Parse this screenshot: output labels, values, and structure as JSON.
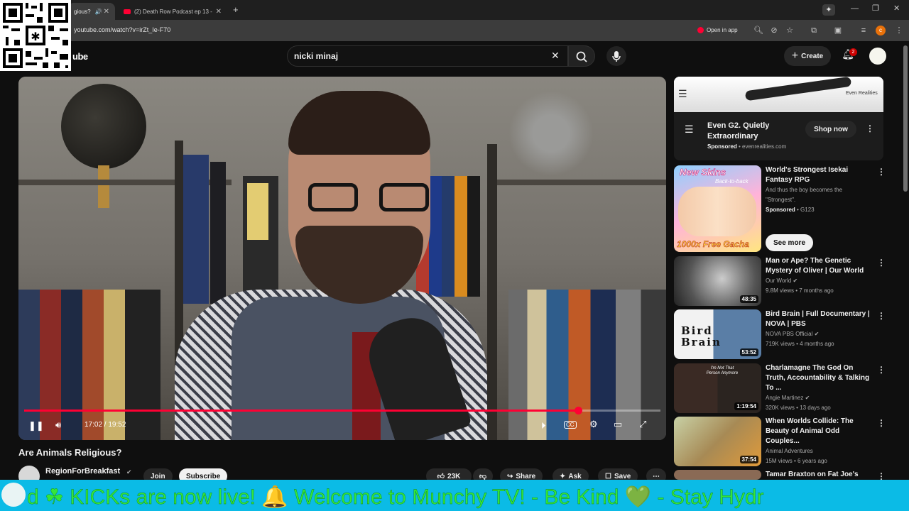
{
  "browser": {
    "tabs": [
      {
        "label": "gious?"
      },
      {
        "label": "(2) Death Row Podcast ep 13 -"
      }
    ],
    "new_tab_icon": "plus-icon",
    "url": "youtube.com/watch?v=irZt_Ie-F70",
    "open_in_app": "Open in app",
    "profile_initial": "c"
  },
  "header": {
    "logo_text": "ube",
    "search_value": "nicki minaj",
    "create_label": "Create",
    "notification_count": "2"
  },
  "player": {
    "progress_fraction": 0.87,
    "time_display": "17:02 / 19:52"
  },
  "video": {
    "title": "Are Animals Religious?",
    "channel": "RegionForBreakfast",
    "join_label": "Join",
    "subscribe_label": "Subscribe",
    "likes": "23K",
    "share_label": "Share",
    "ask_label": "Ask",
    "save_label": "Save"
  },
  "sidebar": {
    "ad": {
      "brand": "Even Realities",
      "title": "Even G2. Quietly Extraordinary",
      "sponsored": "Sponsored",
      "domain": "evenrealities.com",
      "cta": "Shop now"
    },
    "promo": {
      "title": "World's Strongest Isekai Fantasy RPG",
      "desc": "And thus the boy becomes the \"Strongest\".",
      "sponsored": "Sponsored",
      "advertiser": "G123",
      "cta": "See more",
      "thumb_text_top": "New Skins",
      "thumb_text_sub": "Back-to-back",
      "thumb_text_bottom": "1000x Free Gacha"
    },
    "videos": [
      {
        "title": "Man or Ape? The Genetic Mystery of Oliver | Our World",
        "channel": "Our World",
        "meta": "9.8M views • 7 months ago",
        "duration": "48:35"
      },
      {
        "title": "Bird Brain | Full Documentary | NOVA | PBS",
        "channel": "NOVA PBS Official",
        "meta": "719K views • 4 months ago",
        "duration": "53:52",
        "thumb_text": "Bird Brain"
      },
      {
        "title": "Charlamagne The God On Truth, Accountability & Talking To ...",
        "channel": "Angie Martinez",
        "meta": "320K views • 13 days ago",
        "duration": "1:19:54",
        "thumb_text": "I'm Not That Person Anymore"
      },
      {
        "title": "When Worlds Collide: The Beauty of Animal Odd Couples...",
        "channel": "Animal Adventures",
        "meta": "15M views • 6 years ago",
        "duration": "37:54"
      },
      {
        "title": "Tamar Braxton on Fat Joe's",
        "channel": "",
        "meta": "",
        "duration": ""
      }
    ]
  },
  "ticker": {
    "text": "d  ☘  KICKs are now live!  🔔       Welcome to Munchy TV!  - Be Kind  💚  - Stay Hydr"
  }
}
